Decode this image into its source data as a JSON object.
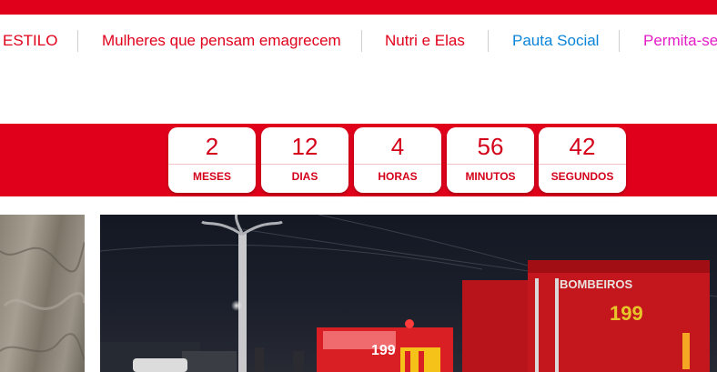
{
  "colors": {
    "brand_red": "#e0001b",
    "nav_blue": "#0a84d8",
    "nav_magenta": "#e31cc6"
  },
  "nav": {
    "items": [
      {
        "label": "ESTILO"
      },
      {
        "label": "Mulheres que pensam emagrecem"
      },
      {
        "label": "Nutri e Elas"
      },
      {
        "label": "Pauta Social"
      },
      {
        "label": "Permita-se"
      }
    ]
  },
  "countdown": {
    "units": [
      {
        "value": "2",
        "label": "MESES"
      },
      {
        "value": "12",
        "label": "DIAS"
      },
      {
        "value": "4",
        "label": "HORAS"
      },
      {
        "value": "56",
        "label": "MINUTOS"
      },
      {
        "value": "42",
        "label": "SEGUNDOS"
      }
    ]
  },
  "photo": {
    "truck_text": "BOMBEIROS",
    "truck_number": "199"
  }
}
